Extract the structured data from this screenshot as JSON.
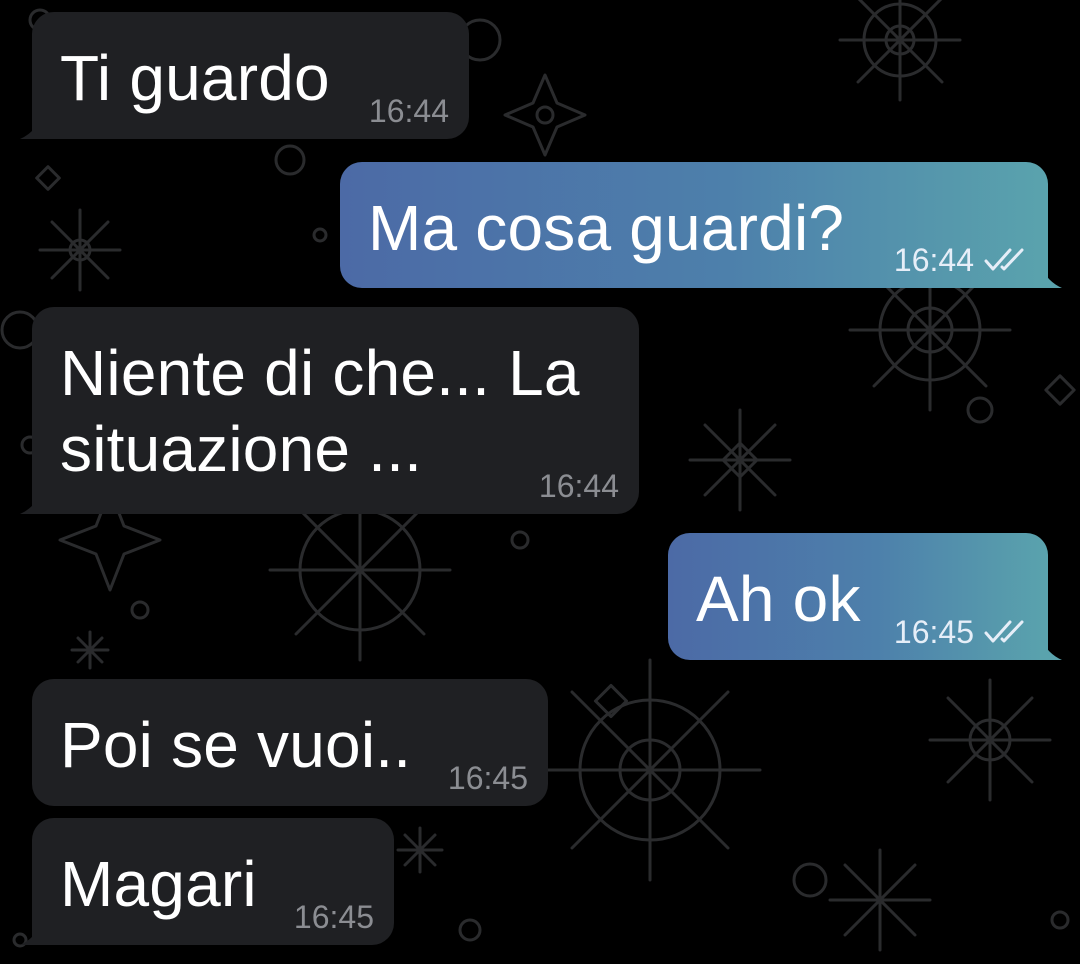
{
  "chat": {
    "messages": [
      {
        "direction": "incoming",
        "text": "Ti guardo",
        "time": "16:44"
      },
      {
        "direction": "outgoing",
        "text": "Ma cosa guardi?",
        "time": "16:44",
        "status_icon": "double-check-icon"
      },
      {
        "direction": "incoming",
        "text": "Niente di che... La\nsituazione ...",
        "time": "16:44"
      },
      {
        "direction": "outgoing",
        "text": "Ah ok",
        "time": "16:45",
        "status_icon": "double-check-icon"
      },
      {
        "direction": "incoming",
        "text": "Poi se vuoi..",
        "time": "16:45"
      },
      {
        "direction": "incoming",
        "text": "Magari",
        "time": "16:45"
      }
    ]
  },
  "colors": {
    "background": "#000000",
    "incoming_bubble": "#1f2023",
    "outgoing_gradient_start": "#4c6aa6",
    "outgoing_gradient_end": "#5aa3ad",
    "text": "#ffffff",
    "incoming_time": "#8b8d92",
    "wallpaper_pattern": "#2a2b2d"
  }
}
